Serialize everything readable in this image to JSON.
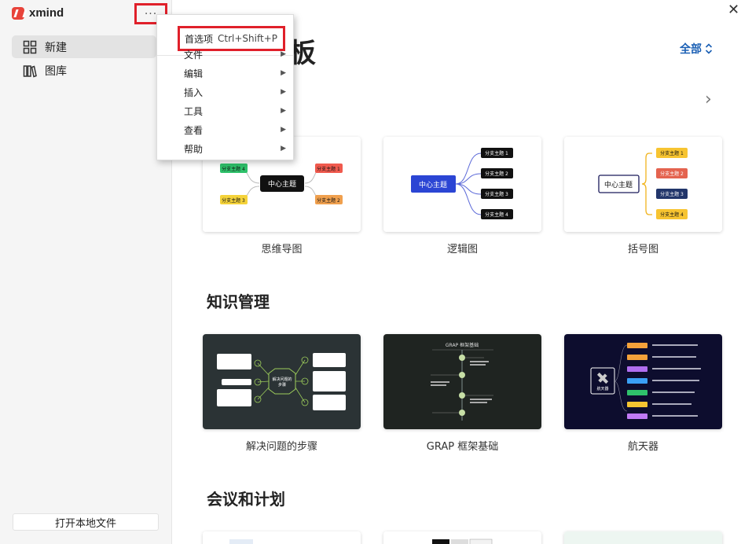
{
  "app": {
    "name": "xmind"
  },
  "sidebar": {
    "more_label": "···",
    "items": [
      {
        "label": "新建"
      },
      {
        "label": "图库"
      }
    ],
    "open_local": "打开本地文件"
  },
  "menu": {
    "preferences_label": "首选项",
    "preferences_shortcut": "Ctrl+Shift+P",
    "items": [
      {
        "label": "文件"
      },
      {
        "label": "编辑"
      },
      {
        "label": "插入"
      },
      {
        "label": "工具"
      },
      {
        "label": "查看"
      },
      {
        "label": "帮助"
      }
    ]
  },
  "header": {
    "partial_title": "板",
    "filter_label": "全部"
  },
  "sections": [
    {
      "title": "",
      "cards": [
        {
          "label": "思维导图",
          "center": "中心主题",
          "topics": [
            "分支主题 4",
            "分支主题 1",
            "分支主题 3",
            "分支主题 2"
          ]
        },
        {
          "label": "逻辑图",
          "center": "中心主题",
          "topics": [
            "分支主题 1",
            "分支主题 2",
            "分支主题 3",
            "分支主题 4"
          ]
        },
        {
          "label": "括号图",
          "center": "中心主题",
          "topics": [
            "分支主题 1",
            "分支主题 2",
            "分支主题 3",
            "分支主题 4"
          ]
        }
      ]
    },
    {
      "title": "知识管理",
      "cards": [
        {
          "label": "解决问题的步骤",
          "center": "解决问题的步骤"
        },
        {
          "label": "GRAP 框架基础",
          "center": "GRAP 框架基础"
        },
        {
          "label": "航天器",
          "center": "航天器"
        }
      ]
    },
    {
      "title": "会议和计划",
      "cards": []
    }
  ],
  "colors": {
    "accent_red": "#e0202a",
    "link_blue": "#1a5fb4",
    "dark_card": "#2b3335",
    "grap_card": "#1f2421",
    "space_card": "#0d0d2e"
  }
}
